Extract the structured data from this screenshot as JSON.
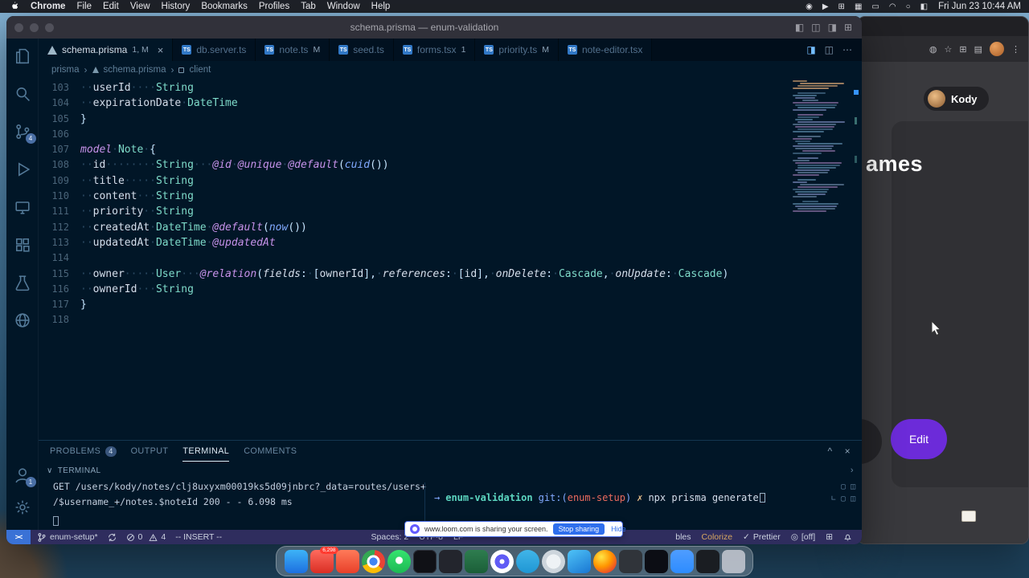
{
  "desktop": {
    "menu_bar": {
      "app_name": "Chrome",
      "menus": [
        "File",
        "Edit",
        "View",
        "History",
        "Bookmarks",
        "Profiles",
        "Tab",
        "Window",
        "Help"
      ],
      "status_icons": [
        "screen-record",
        "play",
        "display",
        "keyboard",
        "battery",
        "wifi",
        "search",
        "control-center"
      ],
      "clock": "Fri Jun 23 10:44 AM"
    },
    "dock_icons": [
      {
        "name": "finder"
      },
      {
        "name": "shield",
        "badge": "6,298"
      },
      {
        "name": "raycast"
      },
      {
        "name": "chrome"
      },
      {
        "name": "whatsapp"
      },
      {
        "name": "iterm"
      },
      {
        "name": "notes"
      },
      {
        "name": "greenapp"
      },
      {
        "name": "loom"
      },
      {
        "name": "telegram"
      },
      {
        "name": "safari"
      },
      {
        "name": "vscode"
      },
      {
        "name": "firefox"
      },
      {
        "name": "notion"
      },
      {
        "name": "warp"
      },
      {
        "name": "zoom"
      },
      {
        "name": "terminal"
      },
      {
        "name": "trash"
      }
    ]
  },
  "vscode": {
    "window_title": "schema.prisma — enum-validation",
    "tabs": [
      {
        "label": "schema.prisma",
        "decoration": "1, M",
        "icon": "prisma",
        "active": true
      },
      {
        "label": "db.server.ts",
        "decoration": "",
        "icon": "ts",
        "active": false
      },
      {
        "label": "note.ts",
        "decoration": "M",
        "icon": "ts",
        "active": false
      },
      {
        "label": "seed.ts",
        "decoration": "",
        "icon": "ts",
        "active": false
      },
      {
        "label": "forms.tsx",
        "decoration": "1",
        "icon": "ts",
        "active": false
      },
      {
        "label": "priority.ts",
        "decoration": "M",
        "icon": "ts",
        "active": false
      },
      {
        "label": "note-editor.tsx",
        "decoration": "",
        "icon": "ts",
        "active": false
      }
    ],
    "breadcrumbs": [
      {
        "label": "prisma",
        "icon": ""
      },
      {
        "label": "schema.prisma",
        "icon": "prisma"
      },
      {
        "label": "client",
        "icon": "symbol"
      }
    ],
    "activity_badges": {
      "source_control": "4",
      "accounts": "1"
    },
    "editor": {
      "first_line_number": 103,
      "lines": [
        [
          [
            "ws",
            "··"
          ],
          [
            "id",
            "userId"
          ],
          [
            "ws",
            "····"
          ],
          [
            "ty",
            "String"
          ]
        ],
        [
          [
            "ws",
            "··"
          ],
          [
            "id",
            "expirationDate"
          ],
          [
            "ws",
            "·"
          ],
          [
            "ty",
            "DateTime"
          ]
        ],
        [
          [
            "pn",
            "}"
          ]
        ],
        [],
        [
          [
            "kw",
            "model"
          ],
          [
            "ws",
            "·"
          ],
          [
            "ty",
            "Note"
          ],
          [
            "ws",
            "·"
          ],
          [
            "pn",
            "{"
          ]
        ],
        [
          [
            "ws",
            "··"
          ],
          [
            "id",
            "id"
          ],
          [
            "ws",
            "········"
          ],
          [
            "ty",
            "String"
          ],
          [
            "ws",
            "···"
          ],
          [
            "at",
            "@id"
          ],
          [
            "ws",
            "·"
          ],
          [
            "at",
            "@unique"
          ],
          [
            "ws",
            "·"
          ],
          [
            "at",
            "@default"
          ],
          [
            "pn",
            "("
          ],
          [
            "fn",
            "cuid"
          ],
          [
            "pn",
            "())"
          ]
        ],
        [
          [
            "ws",
            "··"
          ],
          [
            "id",
            "title"
          ],
          [
            "ws",
            "·····"
          ],
          [
            "ty",
            "String"
          ]
        ],
        [
          [
            "ws",
            "··"
          ],
          [
            "id",
            "content"
          ],
          [
            "ws",
            "···"
          ],
          [
            "ty",
            "String"
          ]
        ],
        [
          [
            "ws",
            "··"
          ],
          [
            "id",
            "priority"
          ],
          [
            "ws",
            "··"
          ],
          [
            "ty",
            "String"
          ]
        ],
        [
          [
            "ws",
            "··"
          ],
          [
            "id",
            "createdAt"
          ],
          [
            "ws",
            "·"
          ],
          [
            "ty",
            "DateTime"
          ],
          [
            "ws",
            "·"
          ],
          [
            "at",
            "@default"
          ],
          [
            "pn",
            "("
          ],
          [
            "fn",
            "now"
          ],
          [
            "pn",
            "())"
          ]
        ],
        [
          [
            "ws",
            "··"
          ],
          [
            "id",
            "updatedAt"
          ],
          [
            "ws",
            "·"
          ],
          [
            "ty",
            "DateTime"
          ],
          [
            "ws",
            "·"
          ],
          [
            "at",
            "@updatedAt"
          ]
        ],
        [],
        [
          [
            "ws",
            "··"
          ],
          [
            "id",
            "owner"
          ],
          [
            "ws",
            "·····"
          ],
          [
            "ty",
            "User"
          ],
          [
            "ws",
            "···"
          ],
          [
            "at",
            "@relation"
          ],
          [
            "pn",
            "("
          ],
          [
            "pr",
            "fields"
          ],
          [
            "pn",
            ":"
          ],
          [
            "ws",
            "·"
          ],
          [
            "pn",
            "["
          ],
          [
            "id",
            "ownerId"
          ],
          [
            "pn",
            "],"
          ],
          [
            "ws",
            "·"
          ],
          [
            "pr",
            "references"
          ],
          [
            "pn",
            ":"
          ],
          [
            "ws",
            "·"
          ],
          [
            "pn",
            "["
          ],
          [
            "id",
            "id"
          ],
          [
            "pn",
            "],"
          ],
          [
            "ws",
            "·"
          ],
          [
            "pr",
            "onDelete"
          ],
          [
            "pn",
            ":"
          ],
          [
            "ws",
            "·"
          ],
          [
            "ty",
            "Cascade"
          ],
          [
            "pn",
            ","
          ],
          [
            "ws",
            "·"
          ],
          [
            "pr",
            "onUpdate"
          ],
          [
            "pn",
            ":"
          ],
          [
            "ws",
            "·"
          ],
          [
            "ty",
            "Cascade"
          ],
          [
            "pn",
            ")"
          ]
        ],
        [
          [
            "ws",
            "··"
          ],
          [
            "id",
            "ownerId"
          ],
          [
            "ws",
            "···"
          ],
          [
            "ty",
            "String"
          ]
        ],
        [
          [
            "pn",
            "}"
          ]
        ],
        []
      ]
    },
    "panel": {
      "tabs": [
        {
          "label": "PROBLEMS",
          "badge": "4",
          "active": false
        },
        {
          "label": "OUTPUT",
          "badge": "",
          "active": false
        },
        {
          "label": "TERMINAL",
          "badge": "",
          "active": true
        },
        {
          "label": "COMMENTS",
          "badge": "",
          "active": false
        }
      ],
      "section_title": "TERMINAL",
      "log_lines": [
        "GET /users/kody/notes/clj8uxyxm00019ks5d09jnbrc?_data=routes/users+",
        "/$username_+/notes.$noteId 200 - - 6.098 ms"
      ],
      "prompt": {
        "arrow": "→",
        "dir": "enum-validation",
        "git_open": "git:(",
        "branch": "enum-setup",
        "git_close": ")",
        "dirty": "✗",
        "command": "npx prisma generate"
      }
    },
    "status_bar": {
      "remote": "><",
      "branch": "enum-setup*",
      "errors": "0",
      "warnings": "4",
      "mode": "-- INSERT --",
      "spaces": "Spaces: 2",
      "encoding": "UTF-8",
      "eol": "LF",
      "clipped_text": "bles",
      "colorize": "Colorize",
      "prettier": "Prettier",
      "copilot": "[off]"
    }
  },
  "loom_bar": {
    "message": "www.loom.com is sharing your screen.",
    "stop_button": "Stop sharing",
    "hide_link": "Hide"
  },
  "browser": {
    "profile_button": "Kody",
    "heading_fragment": "ames",
    "edit_button": "Edit"
  }
}
